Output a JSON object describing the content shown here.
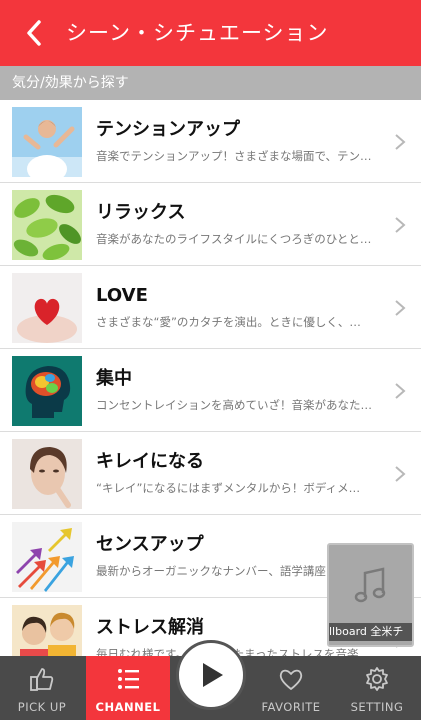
{
  "header": {
    "title": "シーン・シチュエーション",
    "back_icon": "chevron-left-icon",
    "color": "#f3363c"
  },
  "section": {
    "label": "気分/効果から探す"
  },
  "items": [
    {
      "title": "テンションアップ",
      "desc": "音楽でテンションアップ！さまざまな場面で、テン…"
    },
    {
      "title": "リラックス",
      "desc": "音楽があなたのライフスタイルにくつろぎのひとと…"
    },
    {
      "title": "LOVE",
      "desc": "さまざまな“愛”のカタチを演出。ときに優しく、…"
    },
    {
      "title": "集中",
      "desc": "コンセントレイションを高めていざ！音楽があなた…"
    },
    {
      "title": "キレイになる",
      "desc": "“キレイ”になるにはまずメンタルから！ボディメ…"
    },
    {
      "title": "センスアップ",
      "desc": "最新からオーガニックなナンバー、語学講座…"
    },
    {
      "title": "ストレス解消",
      "desc": "毎日むれ様です。あなたのたまったストレスを音楽…"
    }
  ],
  "mini_player": {
    "label": "llboard 全米チ",
    "icon": "music-note-icon"
  },
  "tabs": [
    {
      "label": "PICK UP",
      "icon": "thumbs-up-icon"
    },
    {
      "label": "CHANNEL",
      "icon": "list-icon",
      "active": true
    },
    {
      "label": "FAVORITE",
      "icon": "heart-icon"
    },
    {
      "label": "SETTING",
      "icon": "gear-icon"
    }
  ],
  "play": {
    "icon": "play-icon"
  }
}
